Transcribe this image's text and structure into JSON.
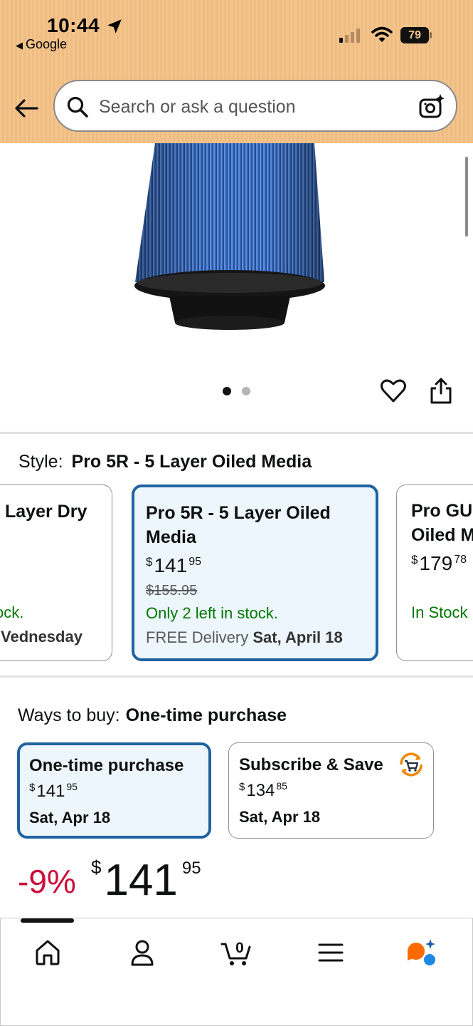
{
  "status_bar": {
    "time": "10:44",
    "back_app": "Google",
    "battery": "79"
  },
  "header": {
    "search_placeholder": "Search or ask a question"
  },
  "gallery": {
    "dots_total": 2,
    "active_dot": 1
  },
  "style": {
    "label": "Style:",
    "selected": "Pro 5R - 5 Layer Oiled Media",
    "cards": [
      {
        "title": "Layer Dry",
        "stock": "ock.",
        "delivery": "Vednesday"
      },
      {
        "title_line1": "Pro 5R - 5 Layer Oiled",
        "title_line2": "Media",
        "price_symbol": "$",
        "price_whole": "141",
        "price_cents": "95",
        "list_price": "$155.95",
        "stock": "Only 2 left in stock.",
        "delivery_prefix": "FREE Delivery",
        "delivery_date": "Sat, April 18"
      },
      {
        "title_line1": "Pro GU",
        "title_line2": "Oiled M",
        "price_symbol": "$",
        "price_whole": "179",
        "price_cents": "78",
        "stock": "In Stock"
      }
    ]
  },
  "ways_to_buy": {
    "label": "Ways to buy:",
    "selected": "One-time purchase",
    "options": [
      {
        "title": "One-time purchase",
        "price_symbol": "$",
        "price_whole": "141",
        "price_cents": "95",
        "date": "Sat, Apr 18"
      },
      {
        "title": "Subscribe & Save",
        "price_symbol": "$",
        "price_whole": "134",
        "price_cents": "85",
        "date": "Sat, Apr 18",
        "icon": "subscribe-cart-icon"
      }
    ]
  },
  "price": {
    "discount": "-9%",
    "symbol": "$",
    "whole": "141",
    "cents": "95"
  },
  "bottom_nav": {
    "items": [
      "home-icon",
      "account-icon",
      "cart-icon",
      "menu-icon",
      "rufus-icon"
    ],
    "cart_count": "0",
    "rufus_color": "#ff6a00",
    "rufus_accent": "#1e88e5"
  },
  "colors": {
    "header_bg": "#f3c48c",
    "selected_border": "#2162a1",
    "selected_bg": "#edf6fd",
    "in_stock": "#007600",
    "discount": "#cc0c39"
  }
}
